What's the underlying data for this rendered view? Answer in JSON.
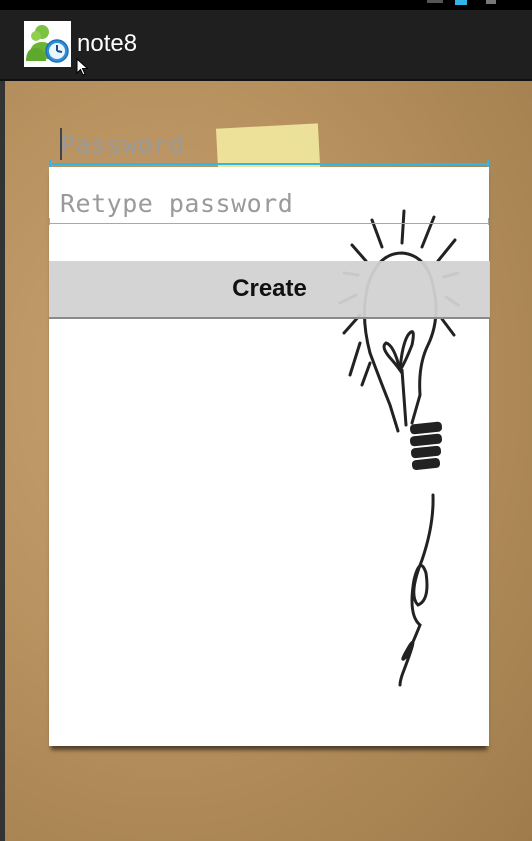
{
  "app": {
    "title": "note8"
  },
  "form": {
    "password_placeholder": "Password",
    "retype_placeholder": "Retype password",
    "create_label": "Create"
  },
  "colors": {
    "actionbar": "#1f1f1f",
    "accent": "#33b5e5",
    "background": "#b8925f",
    "paper": "#ffffff"
  },
  "icons": {
    "app": "person-clock-icon",
    "pointer": "mouse-cursor-icon",
    "decoration": "lightbulb-icon"
  }
}
